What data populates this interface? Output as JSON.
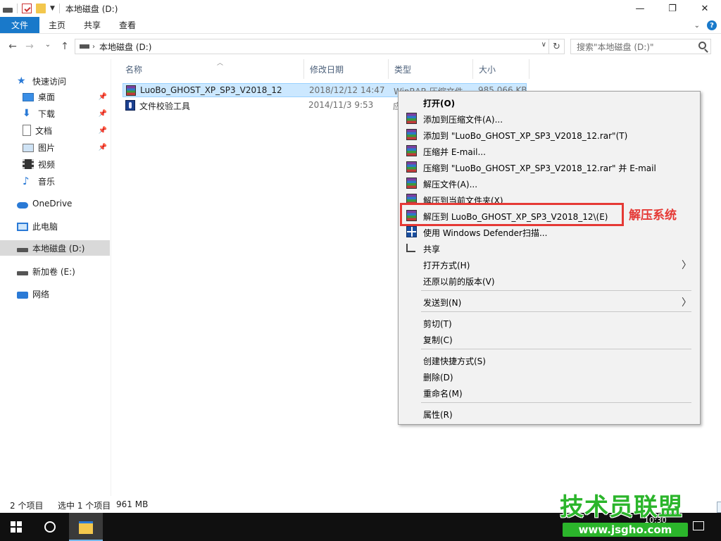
{
  "window": {
    "title": "本地磁盘 (D:)",
    "controls": {
      "minimize": "—",
      "maximize": "❐",
      "close": "✕"
    }
  },
  "ribbon": {
    "tabs": [
      "文件",
      "主页",
      "共享",
      "查看"
    ],
    "expand_chevron": "⌄",
    "help": "?"
  },
  "nav": {
    "back": "←",
    "forward": "→",
    "recent": "⌄",
    "up": "↑"
  },
  "address": {
    "path": "本地磁盘 (D:)",
    "search_placeholder": "搜索\"本地磁盘 (D:)\""
  },
  "sidebar": {
    "items": [
      {
        "label": "快速访问",
        "icon": "star-icon"
      },
      {
        "label": "桌面",
        "icon": "desktop-icon",
        "pinned": true
      },
      {
        "label": "下载",
        "icon": "download-icon",
        "pinned": true
      },
      {
        "label": "文档",
        "icon": "document-icon",
        "pinned": true
      },
      {
        "label": "图片",
        "icon": "picture-icon",
        "pinned": true
      },
      {
        "label": "视频",
        "icon": "video-icon"
      },
      {
        "label": "音乐",
        "icon": "music-icon"
      },
      {
        "label": "OneDrive",
        "icon": "cloud-icon"
      },
      {
        "label": "此电脑",
        "icon": "computer-icon"
      },
      {
        "label": "本地磁盘 (D:)",
        "icon": "drive-icon",
        "selected": true
      },
      {
        "label": "新加卷 (E:)",
        "icon": "drive-icon"
      },
      {
        "label": "网络",
        "icon": "network-icon"
      }
    ]
  },
  "columns": {
    "name": "名称",
    "modified": "修改日期",
    "type": "类型",
    "size": "大小"
  },
  "files": [
    {
      "name": "LuoBo_GHOST_XP_SP3_V2018_12",
      "modified": "2018/12/12 14:47",
      "type": "WinRAR 压缩文件",
      "size": "985,066 KB",
      "icon": "rar-archive-icon"
    },
    {
      "name": "文件校验工具",
      "modified": "2014/11/3 9:53",
      "type": "应",
      "size": "",
      "icon": "checksum-tool-icon"
    }
  ],
  "context_menu": {
    "items": [
      {
        "label": "打开(O)",
        "bold": true
      },
      {
        "label": "添加到压缩文件(A)...",
        "icon": "winrar-icon"
      },
      {
        "label": "添加到 \"LuoBo_GHOST_XP_SP3_V2018_12.rar\"(T)",
        "icon": "winrar-icon"
      },
      {
        "label": "压缩并 E-mail...",
        "icon": "winrar-icon"
      },
      {
        "label": "压缩到 \"LuoBo_GHOST_XP_SP3_V2018_12.rar\" 并 E-mail",
        "icon": "winrar-icon"
      },
      {
        "label": "解压文件(A)...",
        "icon": "winrar-icon"
      },
      {
        "label": "解压到当前文件夹(X)",
        "icon": "winrar-icon"
      },
      {
        "label": "解压到 LuoBo_GHOST_XP_SP3_V2018_12\\(E)",
        "icon": "winrar-icon"
      },
      {
        "label": "使用 Windows Defender扫描...",
        "icon": "defender-icon"
      },
      {
        "label": "共享",
        "icon": "share-icon"
      },
      {
        "label": "打开方式(H)",
        "submenu": true
      },
      {
        "label": "还原以前的版本(V)"
      },
      {
        "label": "发送到(N)",
        "submenu": true
      },
      {
        "label": "剪切(T)"
      },
      {
        "label": "复制(C)"
      },
      {
        "label": "创建快捷方式(S)"
      },
      {
        "label": "删除(D)"
      },
      {
        "label": "重命名(M)"
      },
      {
        "label": "属性(R)"
      }
    ],
    "submenu_arrow": "〉"
  },
  "annotation": {
    "label": "解压系统",
    "color": "#e53935"
  },
  "status": {
    "count": "2 个项目",
    "selected": "选中 1 个项目",
    "size": "961 MB"
  },
  "taskbar": {
    "clock": "10:30"
  },
  "watermark": {
    "title": "技术员联盟",
    "url": "www.jsgho.com",
    "color": "#2bb52b"
  },
  "colors": {
    "accent": "#1979ca",
    "selection": "#cce8ff",
    "selection_border": "#99d1ff"
  }
}
